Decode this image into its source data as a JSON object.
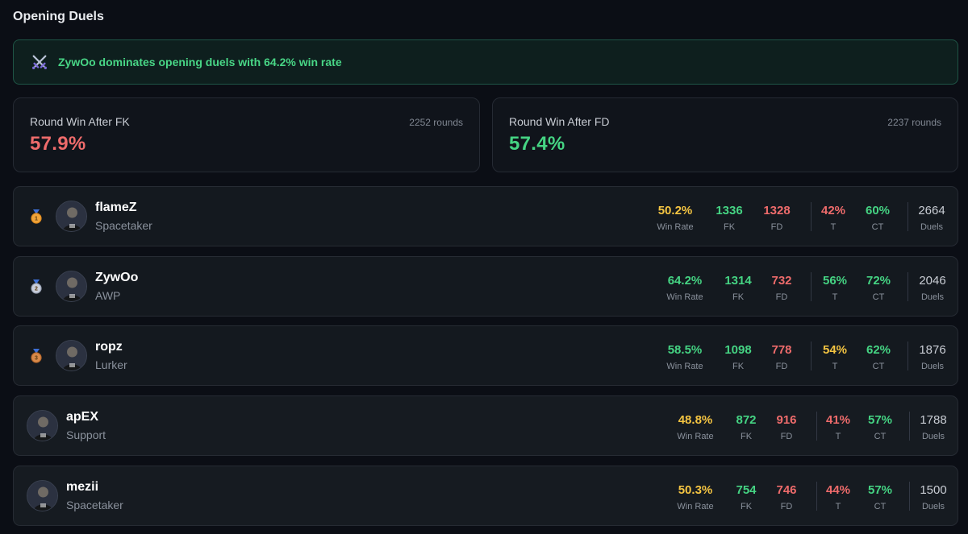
{
  "page": {
    "title": "Opening Duels"
  },
  "insight": {
    "icon": "crossed-swords-icon",
    "text": "ZywOo dominates opening duels with 64.2% win rate"
  },
  "round_win_fk": {
    "label": "Round Win After FK",
    "rounds": "2252 rounds",
    "value": "57.9%",
    "color": "#ee6b6b"
  },
  "round_win_fd": {
    "label": "Round Win After FD",
    "rounds": "2237 rounds",
    "value": "57.4%",
    "color": "#45d483"
  },
  "labels": {
    "win_rate": "Win Rate",
    "fk": "FK",
    "fd": "FD",
    "t": "T",
    "ct": "CT",
    "duels": "Duels"
  },
  "players": [
    {
      "rank": "1",
      "medal": "gold-medal-icon",
      "name": "flameZ",
      "role": "Spacetaker",
      "win_rate": "50.2%",
      "win_rate_color": "yellow",
      "fk": "1336",
      "fd": "1328",
      "t": "42%",
      "t_color": "red",
      "ct": "60%",
      "ct_color": "green",
      "duels": "2664"
    },
    {
      "rank": "2",
      "medal": "silver-medal-icon",
      "name": "ZywOo",
      "role": "AWP",
      "win_rate": "64.2%",
      "win_rate_color": "green",
      "fk": "1314",
      "fd": "732",
      "t": "56%",
      "t_color": "green",
      "ct": "72%",
      "ct_color": "green",
      "duels": "2046"
    },
    {
      "rank": "3",
      "medal": "bronze-medal-icon",
      "name": "ropz",
      "role": "Lurker",
      "win_rate": "58.5%",
      "win_rate_color": "green",
      "fk": "1098",
      "fd": "778",
      "t": "54%",
      "t_color": "yellow",
      "ct": "62%",
      "ct_color": "green",
      "duels": "1876"
    },
    {
      "rank": "",
      "medal": "",
      "name": "apEX",
      "role": "Support",
      "win_rate": "48.8%",
      "win_rate_color": "yellow",
      "fk": "872",
      "fd": "916",
      "t": "41%",
      "t_color": "red",
      "ct": "57%",
      "ct_color": "green",
      "duels": "1788"
    },
    {
      "rank": "",
      "medal": "",
      "name": "mezii",
      "role": "Spacetaker",
      "win_rate": "50.3%",
      "win_rate_color": "yellow",
      "fk": "754",
      "fd": "746",
      "t": "44%",
      "t_color": "red",
      "ct": "57%",
      "ct_color": "green",
      "duels": "1500"
    }
  ]
}
